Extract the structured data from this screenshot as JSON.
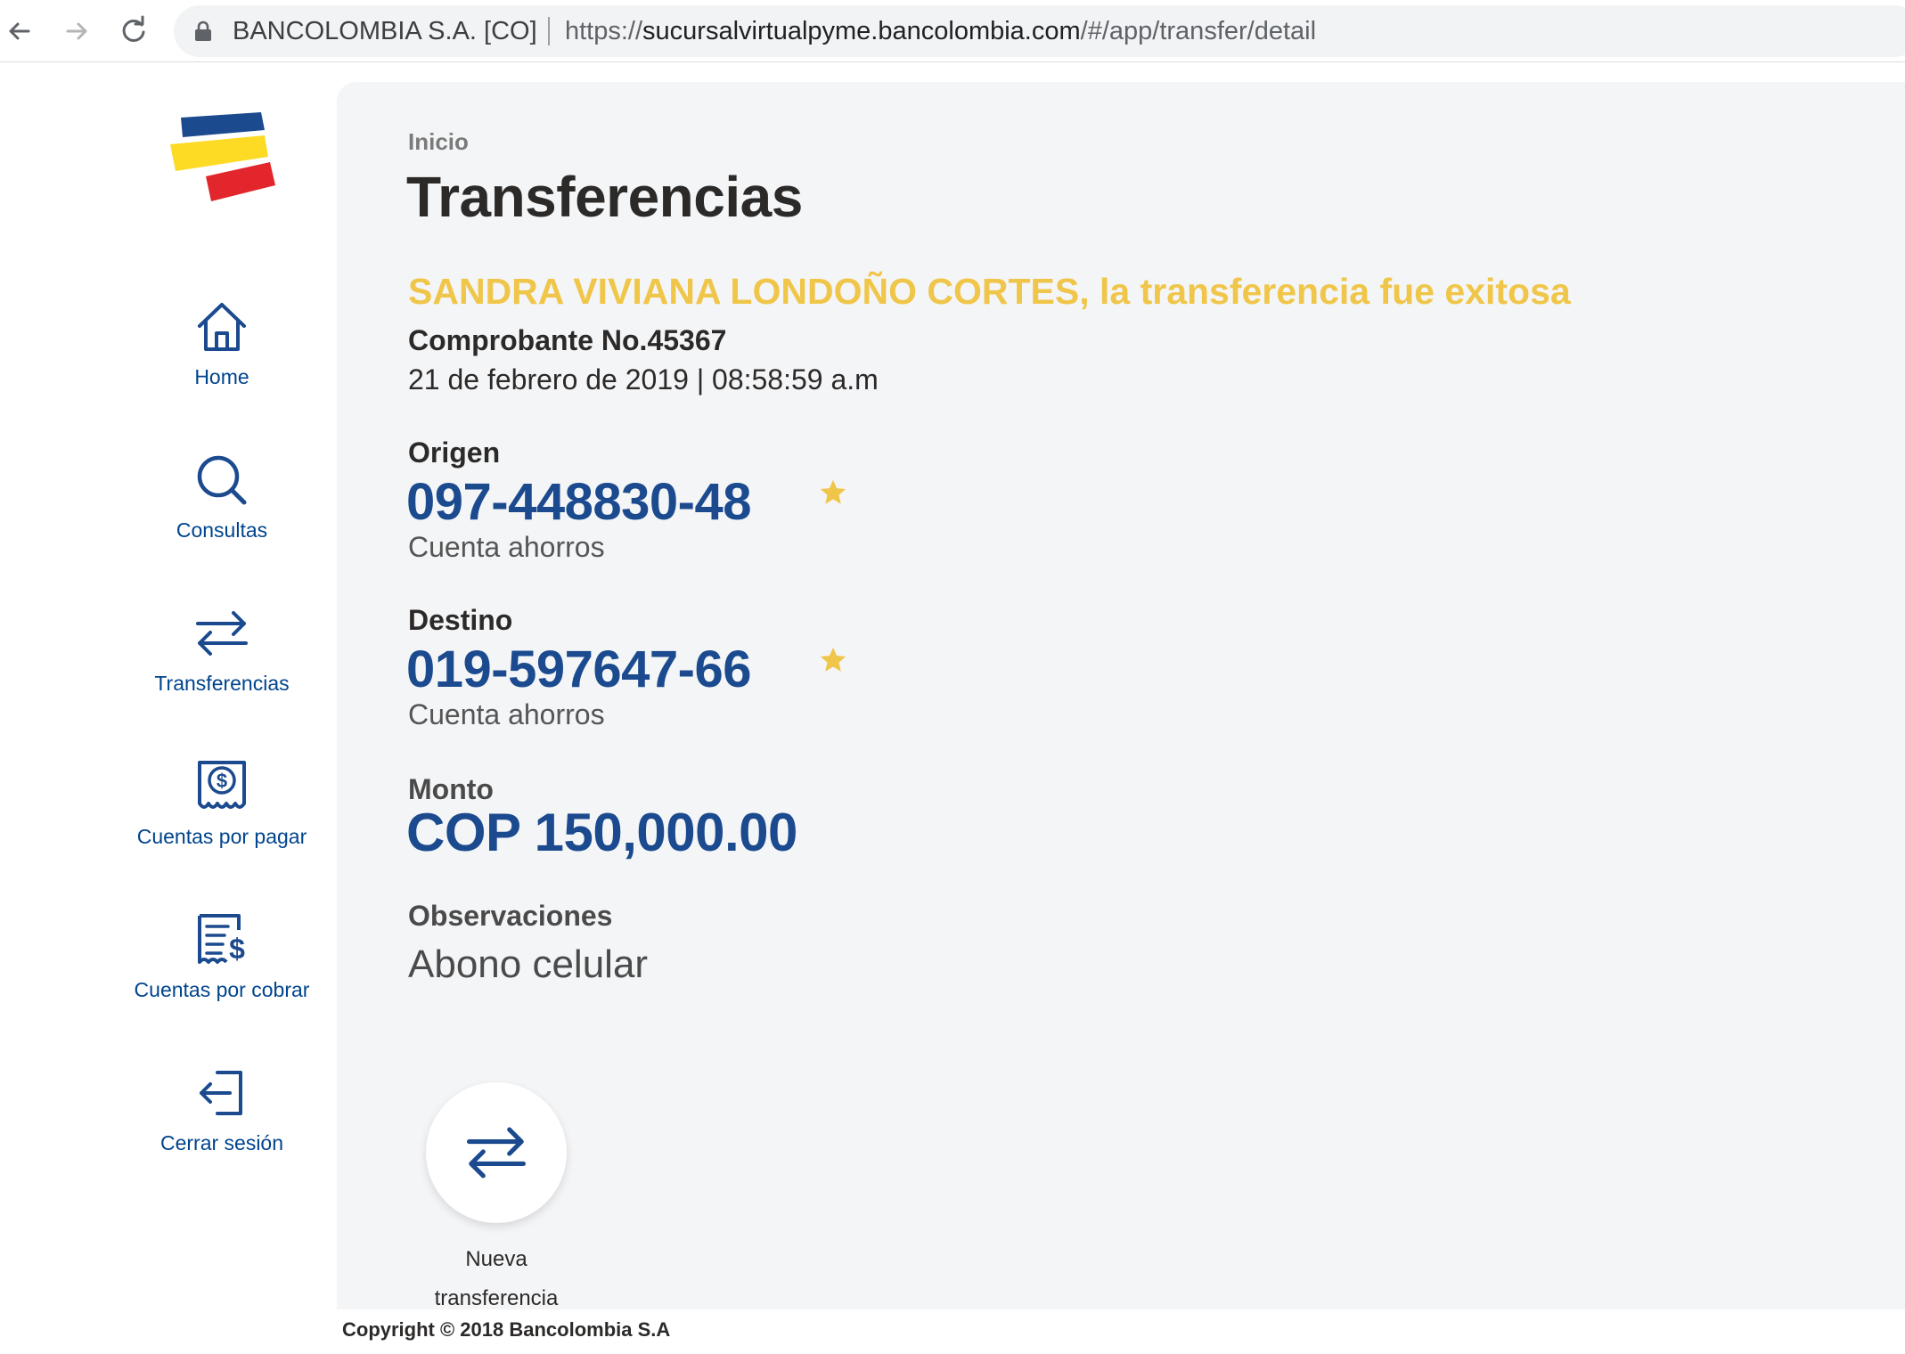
{
  "browser": {
    "site_name": "BANCOLOMBIA S.A. [CO]",
    "url_scheme": "https://",
    "url_host": "sucursalvirtualpyme.bancolombia.com",
    "url_path": "/#/app/transfer/detail"
  },
  "sidebar": {
    "items": [
      {
        "label": "Home",
        "icon": "home-icon"
      },
      {
        "label": "Consultas",
        "icon": "search-icon"
      },
      {
        "label": "Transferencias",
        "icon": "transfer-icon"
      },
      {
        "label": "Cuentas por pagar",
        "icon": "bill-pay-icon"
      },
      {
        "label": "Cuentas por cobrar",
        "icon": "invoice-icon"
      },
      {
        "label": "Cerrar sesión",
        "icon": "logout-icon"
      }
    ]
  },
  "main": {
    "breadcrumb": "Inicio",
    "title": "Transferencias",
    "success_message": "SANDRA VIVIANA LONDOÑO CORTES, la transferencia fue exitosa",
    "voucher": "Comprobante No.45367",
    "datetime": "21 de febrero de 2019 | 08:58:59 a.m",
    "origin": {
      "label": "Origen",
      "account_number": "097-448830-48",
      "account_type": "Cuenta ahorros"
    },
    "destination": {
      "label": "Destino",
      "account_number": "019-597647-66",
      "account_type": "Cuenta ahorros"
    },
    "amount": {
      "label": "Monto",
      "value": "COP 150,000.00"
    },
    "observations": {
      "label": "Observaciones",
      "value": "Abono celular"
    },
    "new_transfer": {
      "label_line1": "Nueva",
      "label_line2": "transferencia"
    }
  },
  "footer": {
    "copyright": "Copyright © 2018 Bancolombia S.A"
  },
  "colors": {
    "brand_blue": "#00448d",
    "account_blue": "#1b4a8f",
    "success_yellow": "#f0c64a",
    "logo_yellow": "#fdda24",
    "logo_red": "#e3262c",
    "panel_bg": "#f4f5f7"
  }
}
